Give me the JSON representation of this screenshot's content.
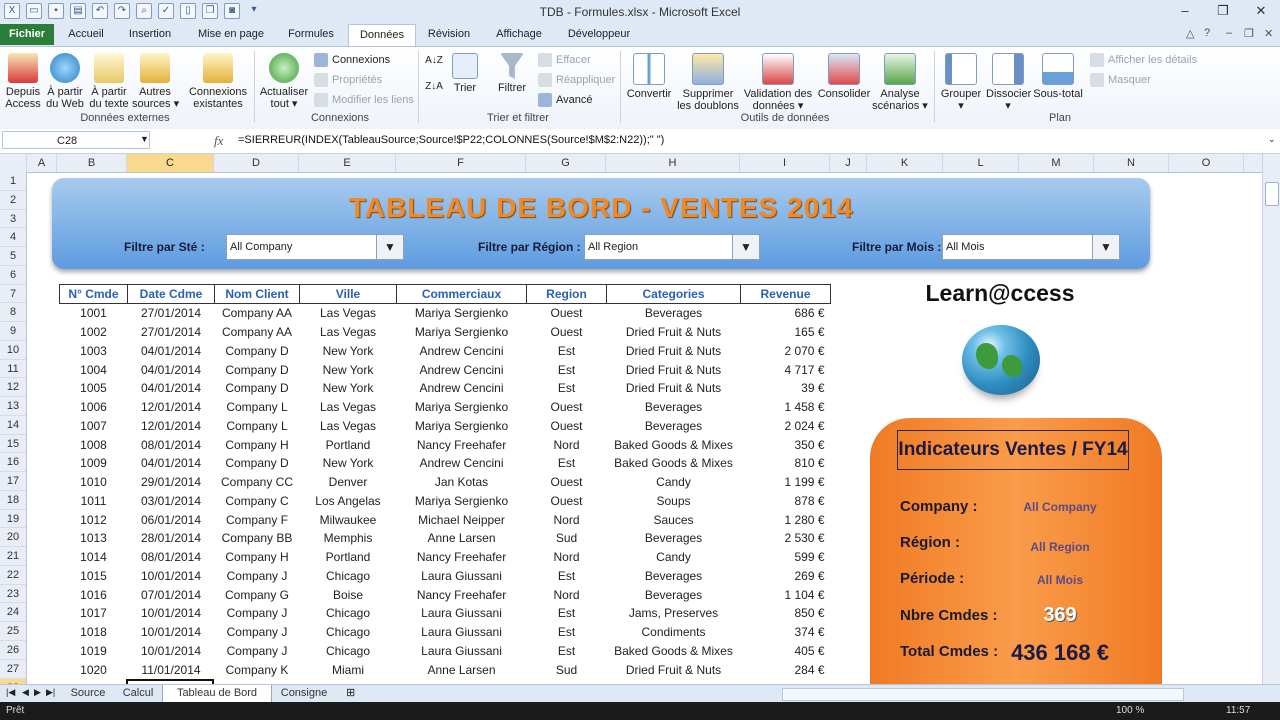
{
  "window": {
    "title": "TDB - Formules.xlsx - Microsoft Excel"
  },
  "tabs": [
    "Fichier",
    "Accueil",
    "Insertion",
    "Mise en page",
    "Formules",
    "Données",
    "Révision",
    "Affichage",
    "Développeur"
  ],
  "ribbon": {
    "get_external": [
      {
        "label": "Depuis\nAccess"
      },
      {
        "label": "À partir\ndu Web"
      },
      {
        "label": "À partir\ndu texte"
      },
      {
        "label": "Autres\nsources ▾"
      },
      {
        "label": "Connexions\nexistantes"
      }
    ],
    "group_external": "Données externes",
    "refresh": "Actualiser\ntout ▾",
    "connections_small": [
      "Connexions",
      "Propriétés",
      "Modifier les liens"
    ],
    "group_connections": "Connexions",
    "sort_label": "Trier",
    "filter_label": "Filtrer",
    "filter_small": [
      "Effacer",
      "Réappliquer",
      "Avancé"
    ],
    "group_sort": "Trier et filtrer",
    "tools": [
      {
        "label": "Convertir"
      },
      {
        "label": "Supprimer\nles doublons"
      },
      {
        "label": "Validation des\ndonnées ▾"
      },
      {
        "label": "Consolider"
      },
      {
        "label": "Analyse\nscénarios ▾"
      }
    ],
    "group_tools": "Outils de données",
    "outline": [
      {
        "label": "Grouper\n▾"
      },
      {
        "label": "Dissocier\n▾"
      },
      {
        "label": "Sous-total"
      }
    ],
    "outline_small": [
      "Afficher les détails",
      "Masquer"
    ],
    "group_outline": "Plan"
  },
  "formula_bar": {
    "name_box": "C28",
    "fx": "fx",
    "formula": "=SIERREUR(INDEX(TableauSource;Source!$P22;COLONNES(Source!$M$2:N22));\" \")"
  },
  "columns": [
    "A",
    "B",
    "C",
    "D",
    "E",
    "F",
    "G",
    "H",
    "I",
    "J",
    "K",
    "L",
    "M",
    "N",
    "O"
  ],
  "selected_column": "C",
  "rows": [
    "1",
    "2",
    "3",
    "4",
    "5",
    "6",
    "7",
    "8",
    "9",
    "10",
    "11",
    "12",
    "13",
    "14",
    "15",
    "16",
    "17",
    "18",
    "19",
    "20",
    "21",
    "22",
    "23",
    "24",
    "25",
    "26",
    "27",
    "28"
  ],
  "dashboard": {
    "title": "TABLEAU DE BORD - VENTES 2014",
    "filters": [
      {
        "label": "Filtre par Sté  :",
        "value": "All Company"
      },
      {
        "label": "Filtre par Région  :",
        "value": "All Region"
      },
      {
        "label": "Filtre par Mois :",
        "value": "All Mois"
      }
    ]
  },
  "table": {
    "headers": [
      "N° Cmde",
      "Date Cdme",
      "Nom Client",
      "Ville",
      "Commerciaux",
      "Region",
      "Categories",
      "Revenue"
    ],
    "rows": [
      [
        "1001",
        "27/01/2014",
        "Company AA",
        "Las Vegas",
        "Mariya Sergienko",
        "Ouest",
        "Beverages",
        "686 €"
      ],
      [
        "1002",
        "27/01/2014",
        "Company AA",
        "Las Vegas",
        "Mariya Sergienko",
        "Ouest",
        "Dried Fruit & Nuts",
        "165 €"
      ],
      [
        "1003",
        "04/01/2014",
        "Company D",
        "New York",
        "Andrew Cencini",
        "Est",
        "Dried Fruit & Nuts",
        "2 070 €"
      ],
      [
        "1004",
        "04/01/2014",
        "Company D",
        "New York",
        "Andrew Cencini",
        "Est",
        "Dried Fruit & Nuts",
        "4 717 €"
      ],
      [
        "1005",
        "04/01/2014",
        "Company D",
        "New York",
        "Andrew Cencini",
        "Est",
        "Dried Fruit & Nuts",
        "39 €"
      ],
      [
        "1006",
        "12/01/2014",
        "Company L",
        "Las Vegas",
        "Mariya Sergienko",
        "Ouest",
        "Beverages",
        "1 458 €"
      ],
      [
        "1007",
        "12/01/2014",
        "Company L",
        "Las Vegas",
        "Mariya Sergienko",
        "Ouest",
        "Beverages",
        "2 024 €"
      ],
      [
        "1008",
        "08/01/2014",
        "Company H",
        "Portland",
        "Nancy Freehafer",
        "Nord",
        "Baked Goods & Mixes",
        "350 €"
      ],
      [
        "1009",
        "04/01/2014",
        "Company D",
        "New York",
        "Andrew Cencini",
        "Est",
        "Baked Goods & Mixes",
        "810 €"
      ],
      [
        "1010",
        "29/01/2014",
        "Company CC",
        "Denver",
        "Jan Kotas",
        "Ouest",
        "Candy",
        "1 199 €"
      ],
      [
        "1011",
        "03/01/2014",
        "Company C",
        "Los Angelas",
        "Mariya Sergienko",
        "Ouest",
        "Soups",
        "878 €"
      ],
      [
        "1012",
        "06/01/2014",
        "Company F",
        "Milwaukee",
        "Michael Neipper",
        "Nord",
        "Sauces",
        "1 280 €"
      ],
      [
        "1013",
        "28/01/2014",
        "Company BB",
        "Memphis",
        "Anne Larsen",
        "Sud",
        "Beverages",
        "2 530 €"
      ],
      [
        "1014",
        "08/01/2014",
        "Company H",
        "Portland",
        "Nancy Freehafer",
        "Nord",
        "Candy",
        "599 €"
      ],
      [
        "1015",
        "10/01/2014",
        "Company J",
        "Chicago",
        "Laura Giussani",
        "Est",
        "Beverages",
        "269 €"
      ],
      [
        "1016",
        "07/01/2014",
        "Company G",
        "Boise",
        "Nancy Freehafer",
        "Nord",
        "Beverages",
        "1 104 €"
      ],
      [
        "1017",
        "10/01/2014",
        "Company J",
        "Chicago",
        "Laura Giussani",
        "Est",
        "Jams, Preserves",
        "850 €"
      ],
      [
        "1018",
        "10/01/2014",
        "Company J",
        "Chicago",
        "Laura Giussani",
        "Est",
        "Condiments",
        "374 €"
      ],
      [
        "1019",
        "10/01/2014",
        "Company J",
        "Chicago",
        "Laura Giussani",
        "Est",
        "Baked Goods & Mixes",
        "405 €"
      ],
      [
        "1020",
        "11/01/2014",
        "Company K",
        "Miami",
        "Anne Larsen",
        "Sud",
        "Dried Fruit & Nuts",
        "284 €"
      ]
    ]
  },
  "brand": "Learn@ccess",
  "kpi": {
    "title": "Indicateurs Ventes  / FY14",
    "items": [
      {
        "label": "Company  :",
        "value": "All Company"
      },
      {
        "label": "Région  :",
        "value": "All Region"
      },
      {
        "label": "Période  :",
        "value": "All Mois"
      },
      {
        "label": "Nbre Cmdes  :",
        "value": "369"
      },
      {
        "label": "Total Cmdes :",
        "value": "436 168 €"
      }
    ]
  },
  "sheets": [
    "Source",
    "Calcul",
    "Tableau de Bord",
    "Consigne"
  ],
  "active_sheet": "Tableau de Bord",
  "status": {
    "ready": "Prêt",
    "zoom": "100 %",
    "clock": "11:57"
  }
}
